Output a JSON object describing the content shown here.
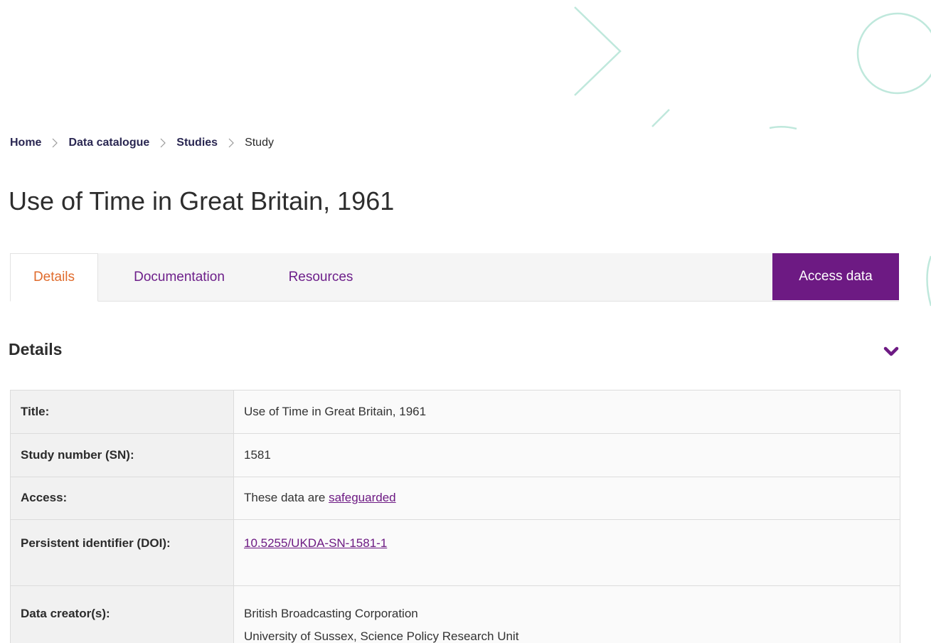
{
  "breadcrumb": {
    "items": [
      "Home",
      "Data catalogue",
      "Studies"
    ],
    "current": "Study"
  },
  "page_title": "Use of Time in Great Britain, 1961",
  "tabs": [
    {
      "label": "Details",
      "active": true
    },
    {
      "label": "Documentation",
      "active": false
    },
    {
      "label": "Resources",
      "active": false
    }
  ],
  "access_button": "Access data",
  "section": {
    "title": "Details",
    "toggle_icon": "chevron-down-icon"
  },
  "details": {
    "title_label": "Title:",
    "title_value": "Use of Time in Great Britain, 1961",
    "sn_label": "Study number (SN):",
    "sn_value": "1581",
    "access_label": "Access:",
    "access_prefix": "These data are ",
    "access_link": "safeguarded",
    "doi_label": "Persistent identifier (DOI):",
    "doi_value": "10.5255/UKDA-SN-1581-1",
    "creators_label": "Data creator(s):",
    "creators": [
      "British Broadcasting Corporation",
      "University of Sussex, Science Policy Research Unit"
    ]
  },
  "colors": {
    "brand_purple": "#6d1a83",
    "active_tab_orange": "#e06b2c",
    "breadcrumb_navy": "#2a2752",
    "decor_mint": "#bfe8dc"
  }
}
